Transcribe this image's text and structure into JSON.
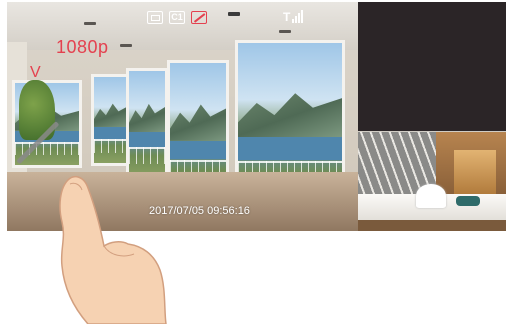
{
  "main_view": {
    "resolution_label": "1080p",
    "mode_label": "V",
    "timestamp": "2017/07/05  09:56:16",
    "status_icons": [
      {
        "name": "sd-card-icon",
        "text": ""
      },
      {
        "name": "channel-icon",
        "text": "C1"
      },
      {
        "name": "no-record-icon",
        "text": ""
      }
    ],
    "signal_text": "T",
    "signal_bars": 4
  },
  "colors": {
    "accent_red": "#e4414f",
    "dark_panel": "#2b2527",
    "overlay_white": "#ffffff"
  }
}
